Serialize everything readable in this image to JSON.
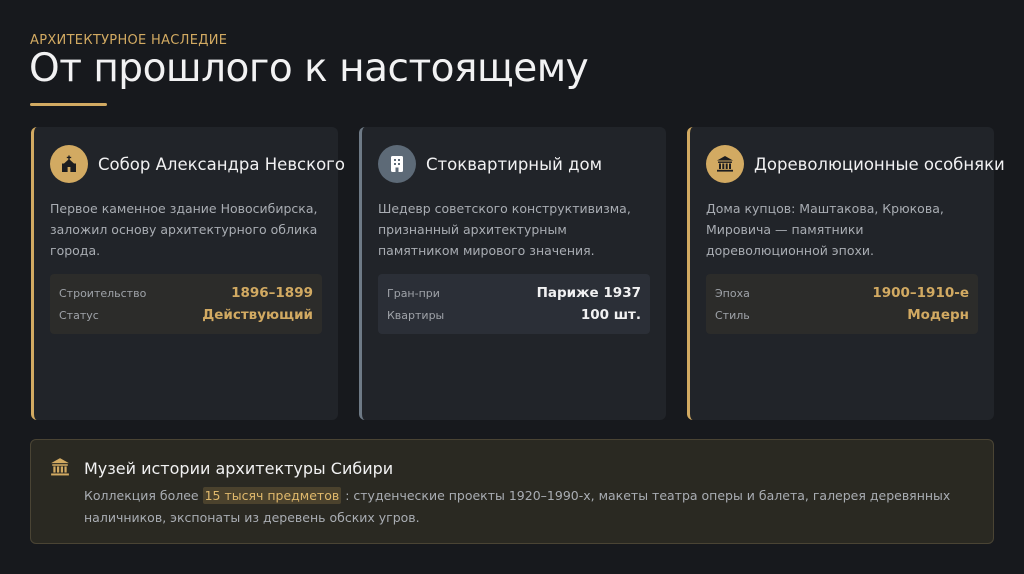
{
  "header": {
    "eyebrow": "АРХИТЕКТУРНОЕ НАСЛЕДИЕ",
    "title": "От прошлого к настоящему"
  },
  "accent_color": "#d2aa62",
  "cards": [
    {
      "icon": "church-icon",
      "title": "Собор Александра Невского",
      "description": "Первое каменное здание Новосибирска, заложил основу архитектурного облика города.",
      "facts": [
        {
          "label": "Строительство",
          "value": "1896–1899"
        },
        {
          "label": "Статус",
          "value": "Действующий"
        }
      ]
    },
    {
      "icon": "building-icon",
      "title": "Стоквартирный дом",
      "description": "Шедевр советского конструктивизма, признанный архитектурным памятником мирового значения.",
      "facts": [
        {
          "label": "Гран-при",
          "value": "Париже 1937"
        },
        {
          "label": "Квартиры",
          "value": "100 шт."
        }
      ]
    },
    {
      "icon": "landmark-icon",
      "title": "Дореволюционные особняки",
      "description": "Дома купцов: Маштакова, Крюкова, Мировича — памятники дореволюционной эпохи.",
      "facts": [
        {
          "label": "Эпоха",
          "value": "1900–1910-е"
        },
        {
          "label": "Стиль",
          "value": "Модерн"
        }
      ]
    }
  ],
  "museum": {
    "icon": "landmark-icon",
    "title": "Музей истории архитектуры Сибири",
    "text_before": "Коллекция более ",
    "highlight": "15 тысяч предметов",
    "text_after": ": студенческие проекты 1920–1990-х, макеты театра оперы и балета, галерея деревянных наличников, экспонаты из деревень обских угров."
  }
}
